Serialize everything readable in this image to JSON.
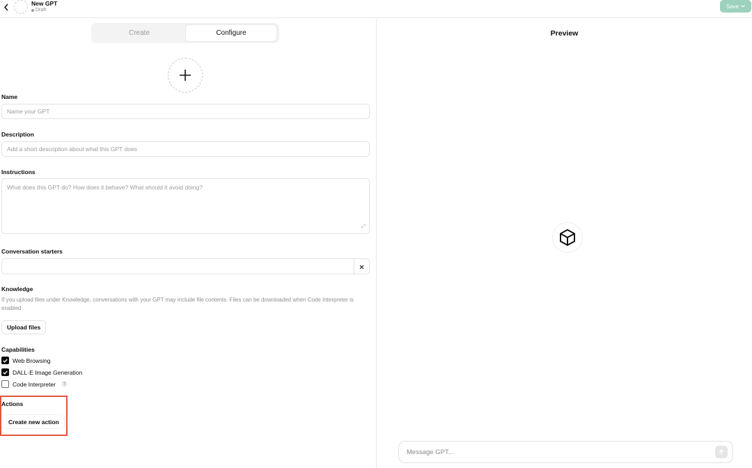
{
  "header": {
    "title": "New GPT",
    "status": "Draft",
    "save_label": "Save"
  },
  "tabs": [
    {
      "label": "Create",
      "active": false
    },
    {
      "label": "Configure",
      "active": true
    }
  ],
  "form": {
    "name": {
      "label": "Name",
      "placeholder": "Name your GPT"
    },
    "description": {
      "label": "Description",
      "placeholder": "Add a short description about what this GPT does"
    },
    "instructions": {
      "label": "Instructions",
      "placeholder": "What does this GPT do? How does it behave? What should it avoid doing?"
    },
    "starters": {
      "label": "Conversation starters",
      "value": ""
    },
    "knowledge": {
      "label": "Knowledge",
      "note": "If you upload files under Knowledge, conversations with your GPT may include file contents. Files can be downloaded when Code Interpreter is enabled",
      "upload_label": "Upload files"
    },
    "capabilities": {
      "label": "Capabilities",
      "items": [
        {
          "label": "Web Browsing",
          "checked": true
        },
        {
          "label": "DALL·E Image Generation",
          "checked": true
        },
        {
          "label": "Code Interpreter",
          "checked": false,
          "help": "?"
        }
      ]
    },
    "actions": {
      "label": "Actions",
      "create_label": "Create new action"
    }
  },
  "preview": {
    "title": "Preview",
    "message_placeholder": "Message GPT..."
  },
  "colors": {
    "save_bg": "#9cd1bd",
    "highlight": "#e2553a",
    "checkbox_on": "#0d0d0d"
  },
  "icons": [
    "back-chevron-icon",
    "chevron-down-icon",
    "plus-icon",
    "expand-icon",
    "close-icon",
    "checkmark-icon",
    "help-icon",
    "cube-icon",
    "arrow-up-icon"
  ]
}
